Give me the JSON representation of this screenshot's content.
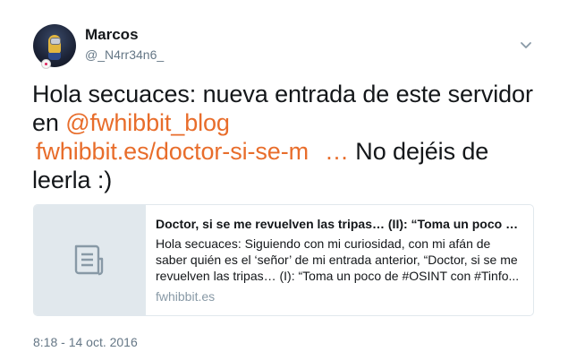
{
  "author": {
    "display_name": "Marcos",
    "handle": "@_N4rr34n6_"
  },
  "tweet": {
    "text_part1": "Hola secuaces: nueva entrada de este servidor en ",
    "mention": "@fwhibbit_blog",
    "link": "fwhibbit.es/doctor-si-se-m",
    "ellipsis": "…",
    "text_part2": " No dejéis de leerla :)",
    "timestamp": "8:18 - 14 oct. 2016"
  },
  "card": {
    "title": "Doctor, si se me revuelven las tripas… (II): “Toma un poco …",
    "description": "Hola secuaces: Siguiendo con mi curiosidad, con mi afán de saber quién es el ‘señor’ de mi entrada anterior, “Doctor, si se me revuelven las tripas… (I): “Toma un poco de #OSINT con #Tinfo...",
    "domain": "fwhibbit.es",
    "thumbnail_icon": "document-icon"
  },
  "icons": {
    "menu": "chevron-down-icon"
  },
  "colors": {
    "link": "#e86d2b",
    "text": "#14171a",
    "muted": "#657786",
    "card_border": "#e1e8ed"
  }
}
